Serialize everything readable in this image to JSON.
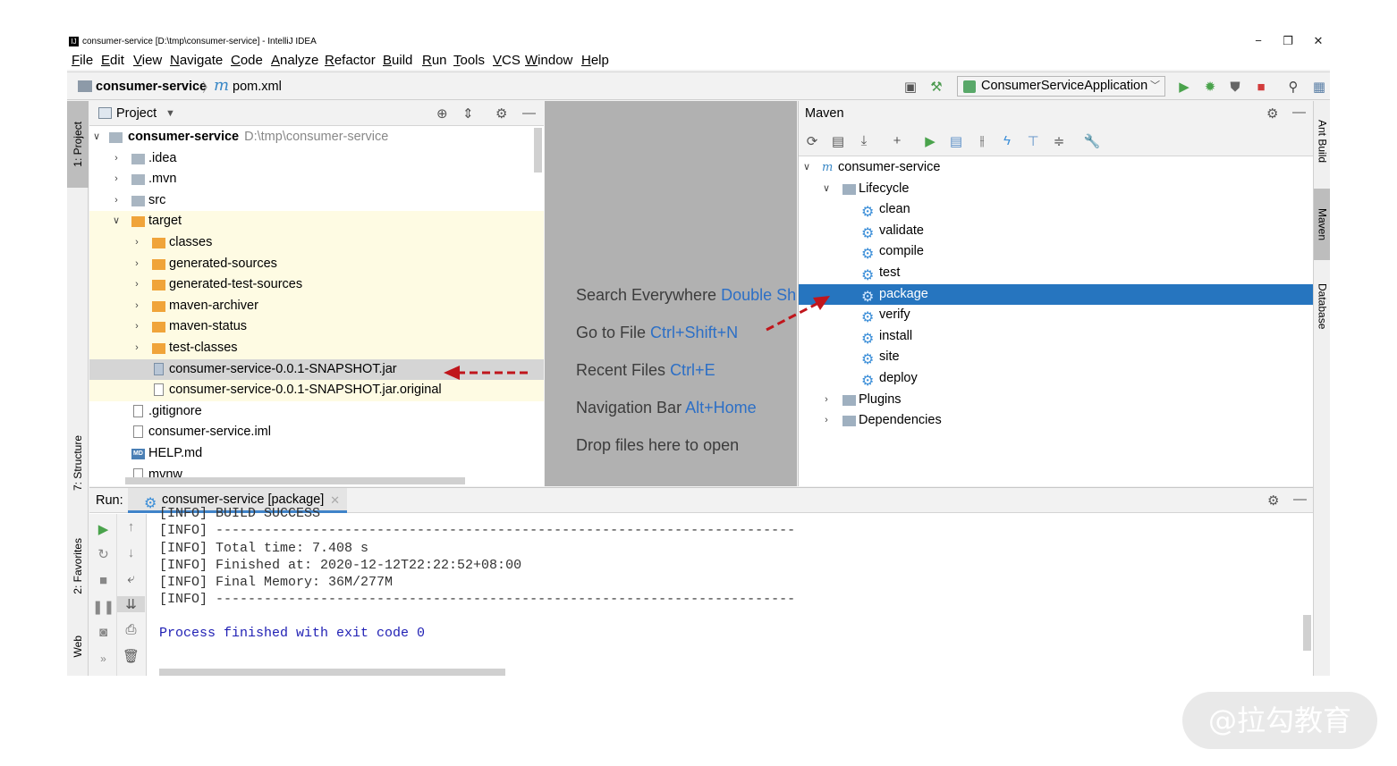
{
  "window": {
    "title": "consumer-service [D:\\tmp\\consumer-service] - IntelliJ IDEA",
    "app_icon": "IJ",
    "controls": {
      "minimize": "−",
      "restore": "❐",
      "close": "✕"
    }
  },
  "menu": [
    "File",
    "Edit",
    "View",
    "Navigate",
    "Code",
    "Analyze",
    "Refactor",
    "Build",
    "Run",
    "Tools",
    "VCS",
    "Window",
    "Help"
  ],
  "breadcrumb": {
    "project": "consumer-service",
    "separator": "〉",
    "file_icon": "m",
    "file": "pom.xml"
  },
  "toolbar": {
    "run_config": "ConsumerServiceApplication",
    "icons": [
      "layout-icon",
      "hammer-icon",
      "run-icon",
      "debug-icon",
      "coverage-icon",
      "stop-icon",
      "search-icon",
      "project-structure-icon"
    ]
  },
  "left_strip": {
    "project_tab": "1: Project",
    "structure_tab": "7: Structure",
    "favorites_tab": "2: Favorites",
    "web_tab": "Web"
  },
  "right_strip": {
    "ant_tab": "Ant Build",
    "maven_tab": "Maven",
    "database_tab": "Database"
  },
  "project_panel": {
    "title": "Project",
    "root": {
      "name": "consumer-service",
      "path": "D:\\tmp\\consumer-service"
    },
    "items": [
      {
        "label": ".idea"
      },
      {
        "label": ".mvn"
      },
      {
        "label": "src"
      },
      {
        "label": "target"
      },
      {
        "label": "classes"
      },
      {
        "label": "generated-sources"
      },
      {
        "label": "generated-test-sources"
      },
      {
        "label": "maven-archiver"
      },
      {
        "label": "maven-status"
      },
      {
        "label": "test-classes"
      },
      {
        "label": "consumer-service-0.0.1-SNAPSHOT.jar"
      },
      {
        "label": "consumer-service-0.0.1-SNAPSHOT.jar.original"
      },
      {
        "label": ".gitignore"
      },
      {
        "label": "consumer-service.iml"
      },
      {
        "label": "HELP.md"
      },
      {
        "label": "mvnw"
      }
    ]
  },
  "editor_hints": [
    {
      "text": "Search Everywhere",
      "key": "Double Shift"
    },
    {
      "text": "Go to File",
      "key": "Ctrl+Shift+N"
    },
    {
      "text": "Recent Files",
      "key": "Ctrl+E"
    },
    {
      "text": "Navigation Bar",
      "key": "Alt+Home"
    },
    {
      "text": "Drop files here to open",
      "key": ""
    }
  ],
  "maven_panel": {
    "title": "Maven",
    "root": "consumer-service",
    "lifecycle": "Lifecycle",
    "phases": [
      "clean",
      "validate",
      "compile",
      "test",
      "package",
      "verify",
      "install",
      "site",
      "deploy"
    ],
    "selected_phase": "package",
    "plugins": "Plugins",
    "dependencies": "Dependencies"
  },
  "run_panel": {
    "label": "Run:",
    "tab": "consumer-service [package]",
    "lines": [
      "[INFO] BUILD SUCCESS",
      "[INFO] ------------------------------------------------------------------------",
      "[INFO] Total time: 7.408 s",
      "[INFO] Finished at: 2020-12-12T22:22:52+08:00",
      "[INFO] Final Memory: 36M/277M",
      "[INFO] ------------------------------------------------------------------------"
    ],
    "finish": "Process finished with exit code 0"
  },
  "watermark": "@拉勾教育",
  "colors": {
    "selection": "#2675bf",
    "hint_key": "#2c6fc6",
    "excluded_bg": "#fefbe3",
    "arrow": "#c0161c"
  }
}
